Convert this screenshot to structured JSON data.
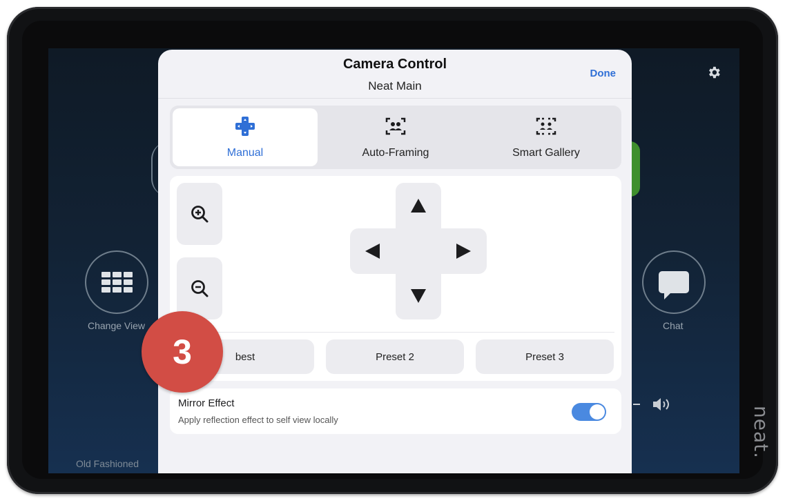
{
  "background": {
    "change_view_label": "Change View",
    "chat_label": "Chat",
    "room_name": "Old Fashioned",
    "gear_icon": "gear-icon",
    "volume_icon": "speaker-icon"
  },
  "brand": "neat.",
  "modal": {
    "title": "Camera Control",
    "subtitle": "Neat Main",
    "done_label": "Done",
    "tabs": [
      {
        "label": "Manual",
        "icon": "dpad-icon",
        "active": true
      },
      {
        "label": "Auto-Framing",
        "icon": "people-frame-icon",
        "active": false
      },
      {
        "label": "Smart Gallery",
        "icon": "gallery-frame-icon",
        "active": false
      }
    ],
    "zoom_in_icon": "zoom-in-icon",
    "zoom_out_icon": "zoom-out-icon",
    "presets": [
      "best",
      "Preset 2",
      "Preset 3"
    ],
    "mirror": {
      "title": "Mirror Effect",
      "description": "Apply reflection effect to self view locally",
      "enabled": true
    }
  },
  "step_badge": "3",
  "colors": {
    "accent": "#2f6fd6",
    "badge": "#d24d45",
    "toggle_on": "#4a89e0"
  }
}
